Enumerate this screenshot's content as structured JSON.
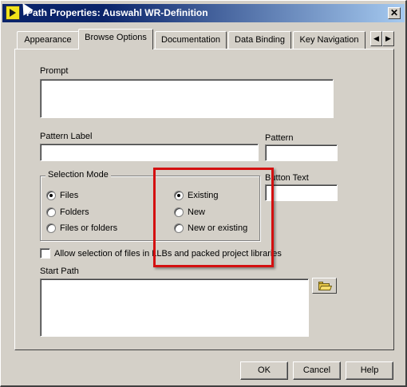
{
  "window": {
    "title": "Path Properties: Auswahl WR-Definition",
    "close_glyph": "✕"
  },
  "tabs": [
    {
      "label": "Appearance",
      "active": false
    },
    {
      "label": "Browse Options",
      "active": true
    },
    {
      "label": "Documentation",
      "active": false
    },
    {
      "label": "Data Binding",
      "active": false
    },
    {
      "label": "Key Navigation",
      "active": false
    }
  ],
  "tab_scroll": {
    "left_glyph": "◀",
    "right_glyph": "▶"
  },
  "browse_options": {
    "prompt_label": "Prompt",
    "prompt_value": "",
    "pattern_label_label": "Pattern Label",
    "pattern_label_value": "",
    "pattern_label": "Pattern",
    "pattern_value": "",
    "button_text_label": "Button Text",
    "button_text_value": "",
    "selection_mode": {
      "title": "Selection Mode",
      "type_options": [
        {
          "label": "Files",
          "checked": true
        },
        {
          "label": "Folders",
          "checked": false
        },
        {
          "label": "Files or folders",
          "checked": false
        }
      ],
      "existence_options": [
        {
          "label": "Existing",
          "checked": true
        },
        {
          "label": "New",
          "checked": false
        },
        {
          "label": "New or existing",
          "checked": false
        }
      ]
    },
    "allow_llb_label": "Allow selection of files in LLBs and packed project libraries",
    "allow_llb_checked": false,
    "start_path_label": "Start Path",
    "start_path_value": ""
  },
  "buttons": {
    "ok": "OK",
    "cancel": "Cancel",
    "help": "Help"
  },
  "icons": {
    "title_icon": "labview-vi-icon",
    "browse_icon": "open-folder-icon"
  },
  "colors": {
    "dialog_bg": "#d4d0c8",
    "titlebar_start": "#0a246a",
    "titlebar_end": "#a6caf0",
    "highlight": "#d41010"
  }
}
